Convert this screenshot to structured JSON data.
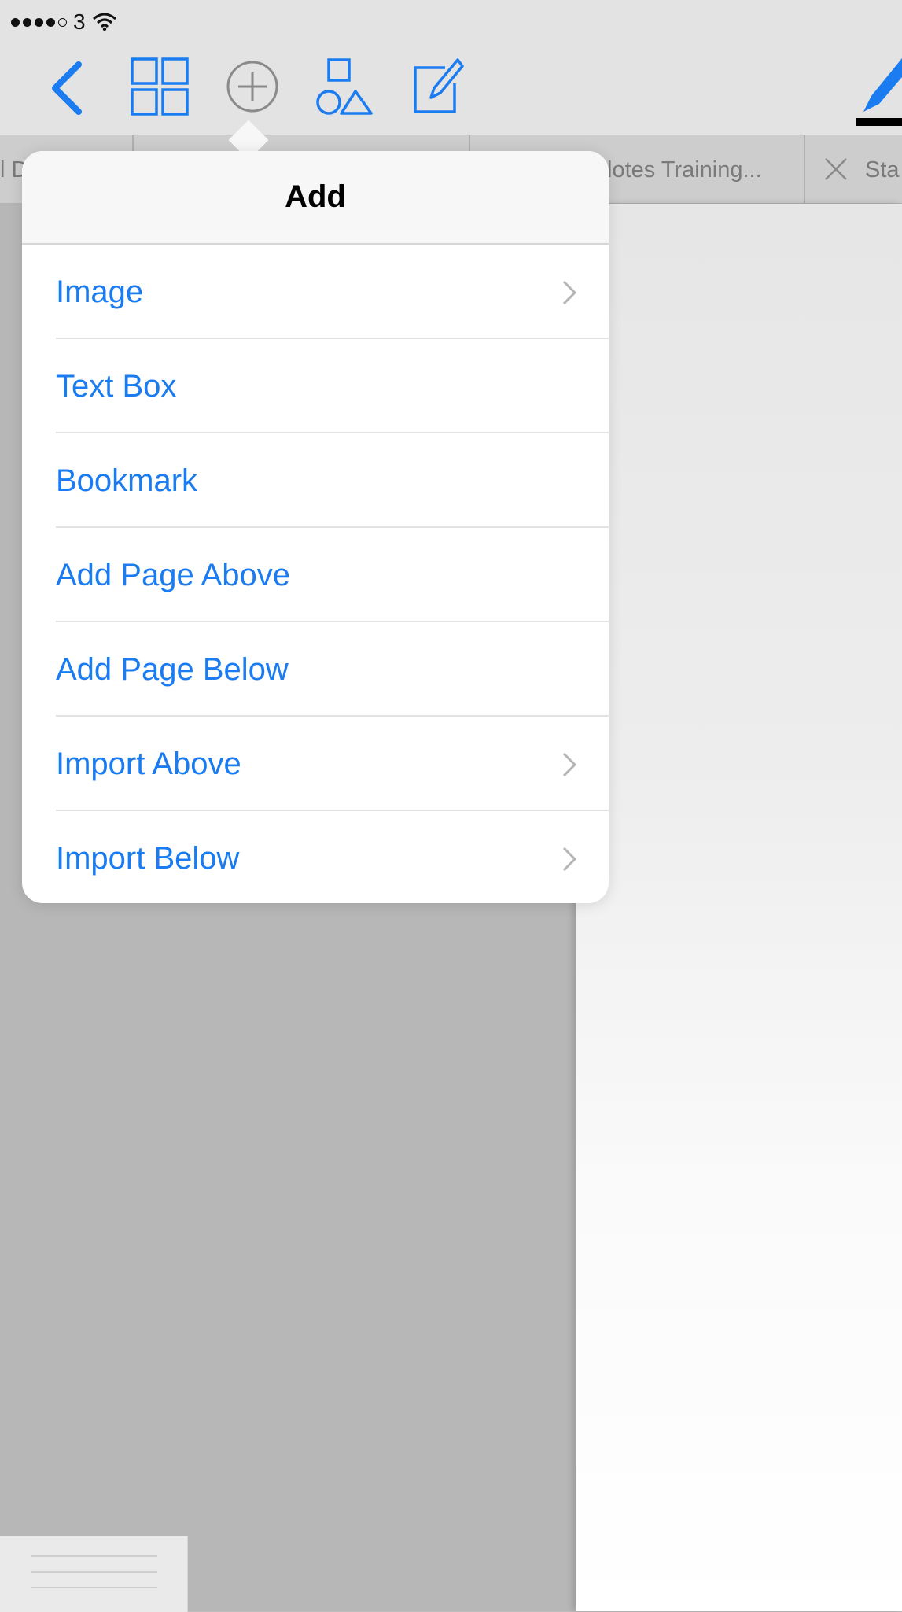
{
  "status_bar": {
    "carrier": "3",
    "signal_bars_filled": 4,
    "signal_bars_total": 5
  },
  "toolbar": {
    "icons": [
      "back-chevron-icon",
      "grid-view-icon",
      "add-circle-icon",
      "shapes-icon",
      "compose-icon",
      "pen-icon"
    ],
    "accent_color": "#1a7cf0"
  },
  "tabs": [
    {
      "label": "l D"
    },
    {
      "label": ""
    },
    {
      "label": "lotes Training..."
    },
    {
      "label": "Sta"
    }
  ],
  "popover": {
    "title": "Add",
    "items": [
      {
        "label": "Image",
        "has_submenu": true
      },
      {
        "label": "Text Box",
        "has_submenu": false
      },
      {
        "label": "Bookmark",
        "has_submenu": false
      },
      {
        "label": "Add Page Above",
        "has_submenu": false
      },
      {
        "label": "Add Page Below",
        "has_submenu": false
      },
      {
        "label": "Import Above",
        "has_submenu": true
      },
      {
        "label": "Import Below",
        "has_submenu": true
      }
    ]
  }
}
